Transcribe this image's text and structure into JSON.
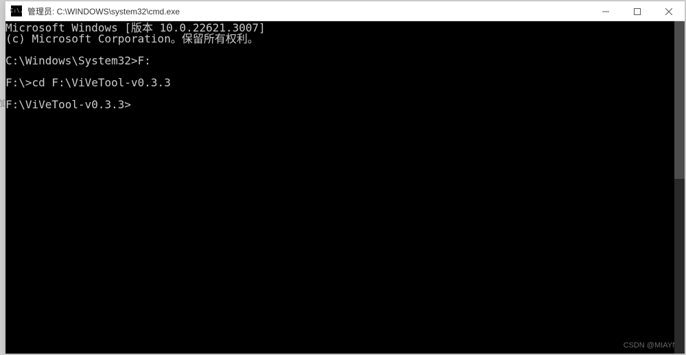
{
  "window": {
    "title": "管理员: C:\\WINDOWS\\system32\\cmd.exe",
    "icon_text": "C:\\."
  },
  "terminal": {
    "lines": [
      "Microsoft Windows [版本 10.0.22621.3007]",
      "(c) Microsoft Corporation。保留所有权利。",
      "",
      "C:\\Windows\\System32>F:",
      "",
      "F:\\>cd F:\\ViVeTool-v0.3.3",
      "",
      "F:\\ViVeTool-v0.3.3>"
    ]
  },
  "watermark": "CSDN @MIAYN",
  "left_char": "加"
}
